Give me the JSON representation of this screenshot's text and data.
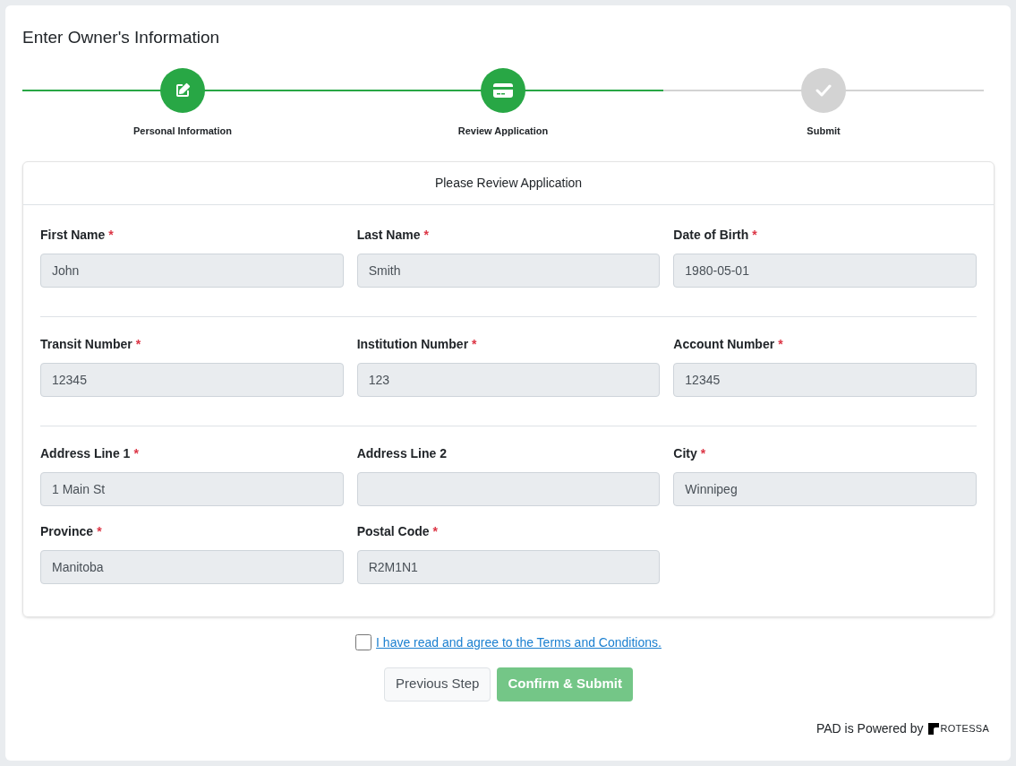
{
  "page_title": "Enter Owner's Information",
  "steps": [
    {
      "label": "Personal Information",
      "done": true,
      "kind": "edit"
    },
    {
      "label": "Review Application",
      "done": true,
      "kind": "card"
    },
    {
      "label": "Submit",
      "done": false,
      "kind": "check"
    }
  ],
  "panel": {
    "title": "Please Review Application",
    "required_mark": "*",
    "groups": [
      {
        "fields": [
          {
            "label": "First Name",
            "required": true,
            "value": "John"
          },
          {
            "label": "Last Name",
            "required": true,
            "value": "Smith"
          },
          {
            "label": "Date of Birth",
            "required": true,
            "value": "1980-05-01"
          }
        ]
      },
      {
        "fields": [
          {
            "label": "Transit Number",
            "required": true,
            "value": "12345"
          },
          {
            "label": "Institution Number",
            "required": true,
            "value": "123"
          },
          {
            "label": "Account Number",
            "required": true,
            "value": "12345"
          }
        ]
      },
      {
        "fields": [
          {
            "label": "Address Line 1",
            "required": true,
            "value": "1 Main St"
          },
          {
            "label": "Address Line 2",
            "required": false
          },
          {
            "label": "City",
            "required": true,
            "value": "Winnipeg"
          },
          {
            "label": "Province",
            "required": true,
            "value": "Manitoba"
          },
          {
            "label": "Postal Code",
            "required": true,
            "value": "R2M1N1"
          }
        ]
      }
    ]
  },
  "agree": {
    "label": "I have read and agree to the Terms and Conditions.",
    "checked": false
  },
  "buttons": [
    {
      "label": "Previous Step",
      "kind": "secondary"
    },
    {
      "label": "Confirm & Submit",
      "kind": "primary"
    }
  ],
  "footer": {
    "text": "PAD is Powered by",
    "logo_text": "ROTESSA"
  }
}
